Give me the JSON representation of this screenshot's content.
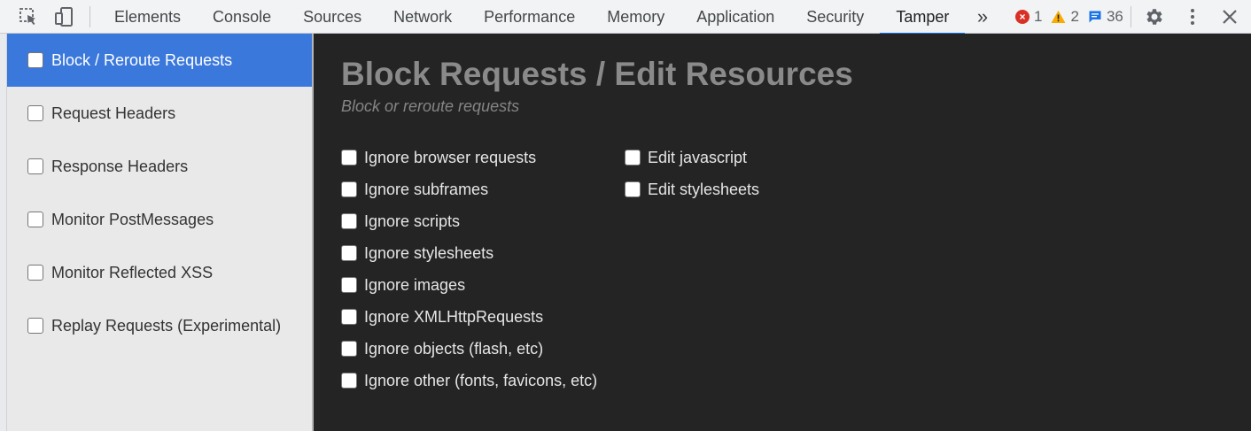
{
  "toolbar": {
    "inspect_icon": "inspect-element-icon",
    "device_icon": "device-toolbar-icon",
    "tabs": [
      {
        "label": "Elements"
      },
      {
        "label": "Console"
      },
      {
        "label": "Sources"
      },
      {
        "label": "Network"
      },
      {
        "label": "Performance"
      },
      {
        "label": "Memory"
      },
      {
        "label": "Application"
      },
      {
        "label": "Security"
      },
      {
        "label": "Tamper"
      }
    ],
    "active_tab": "Tamper",
    "more_label": "»",
    "errors": "1",
    "warnings": "2",
    "messages": "36",
    "colors": {
      "error": "#d93025",
      "warning": "#f9ab00",
      "info": "#1a73e8",
      "active_tab": "#1a73e8"
    }
  },
  "sidebar": {
    "items": [
      {
        "label": "Block / Reroute Requests",
        "selected": true
      },
      {
        "label": "Request Headers"
      },
      {
        "label": "Response Headers"
      },
      {
        "label": "Monitor PostMessages"
      },
      {
        "label": "Monitor Reflected XSS"
      },
      {
        "label": "Replay Requests (Experimental)"
      }
    ],
    "selected_color": "#3b78dc"
  },
  "main": {
    "title": "Block Requests / Edit Resources",
    "subtitle": "Block or reroute requests",
    "left_options": [
      {
        "label": "Ignore browser requests"
      },
      {
        "label": "Ignore subframes"
      },
      {
        "label": "Ignore scripts"
      },
      {
        "label": "Ignore stylesheets"
      },
      {
        "label": "Ignore images"
      },
      {
        "label": "Ignore XMLHttpRequests"
      },
      {
        "label": "Ignore objects (flash, etc)"
      },
      {
        "label": "Ignore other (fonts, favicons, etc)"
      }
    ],
    "right_options": [
      {
        "label": "Edit javascript"
      },
      {
        "label": "Edit stylesheets"
      }
    ],
    "background": "#242424"
  }
}
